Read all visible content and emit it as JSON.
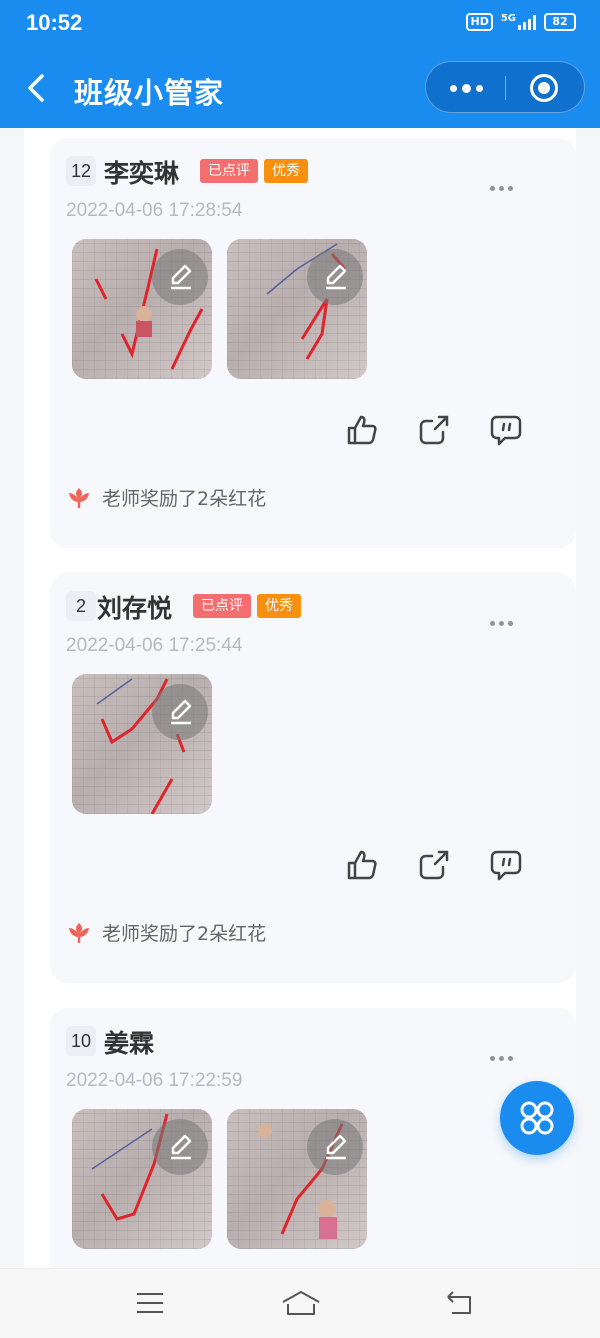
{
  "status_bar": {
    "time": "10:52",
    "hd": "HD",
    "network": "5G",
    "battery": "82"
  },
  "nav": {
    "title": "班级小管家"
  },
  "posts": [
    {
      "index": "12",
      "name": "李奕琳",
      "tags": [
        "已点评",
        "优秀"
      ],
      "timestamp": "2022-04-06 17:28:54",
      "photo_count": 2,
      "reward_text": "老师奖励了2朵红花"
    },
    {
      "index": "2",
      "name": "刘存悦",
      "tags": [
        "已点评",
        "优秀"
      ],
      "timestamp": "2022-04-06 17:25:44",
      "photo_count": 1,
      "reward_text": "老师奖励了2朵红花"
    },
    {
      "index": "10",
      "name": "姜霖",
      "tags": [],
      "timestamp": "2022-04-06 17:22:59",
      "photo_count": 2
    }
  ],
  "colors": {
    "brand_blue": "#1a8cf0",
    "tag_red": "#f36f6f",
    "tag_orange": "#f6900e",
    "flower_red": "#f0645a"
  },
  "icons": {
    "back": "back-arrow-icon",
    "more": "more-dots-icon",
    "close": "target-icon",
    "edit": "pencil-icon",
    "like": "thumbs-up-icon",
    "share": "share-icon",
    "comment": "comment-icon",
    "flower": "flower-icon",
    "fab": "grid-menu-icon"
  }
}
